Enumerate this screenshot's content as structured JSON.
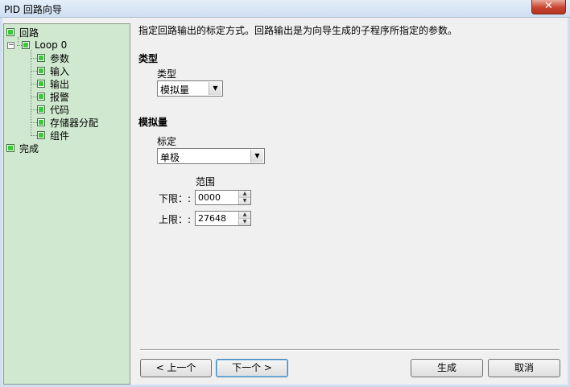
{
  "window": {
    "title": "PID 回路向导",
    "close_glyph": "✕"
  },
  "tree": {
    "root": "回路",
    "loop": "Loop 0",
    "expander": "−",
    "children": [
      "参数",
      "输入",
      "输出",
      "报警",
      "代码",
      "存储器分配",
      "组件"
    ],
    "done": "完成"
  },
  "content": {
    "description": "指定回路输出的标定方式。回路输出是为向导生成的子程序所指定的参数。",
    "type_section": {
      "title": "类型",
      "label": "类型",
      "value": "模拟量"
    },
    "analog_section": {
      "title": "模拟量",
      "scale_label": "标定",
      "scale_value": "单极",
      "range_label": "范围",
      "low_label": "下限：:",
      "low_value": "0000",
      "high_label": "上限：:",
      "high_value": "27648"
    }
  },
  "buttons": {
    "prev": "< 上一个",
    "next": "下一个 >",
    "generate": "生成",
    "cancel": "取消"
  },
  "glyphs": {
    "dropdown": "▼",
    "spin_up": "▲",
    "spin_down": "▼"
  }
}
